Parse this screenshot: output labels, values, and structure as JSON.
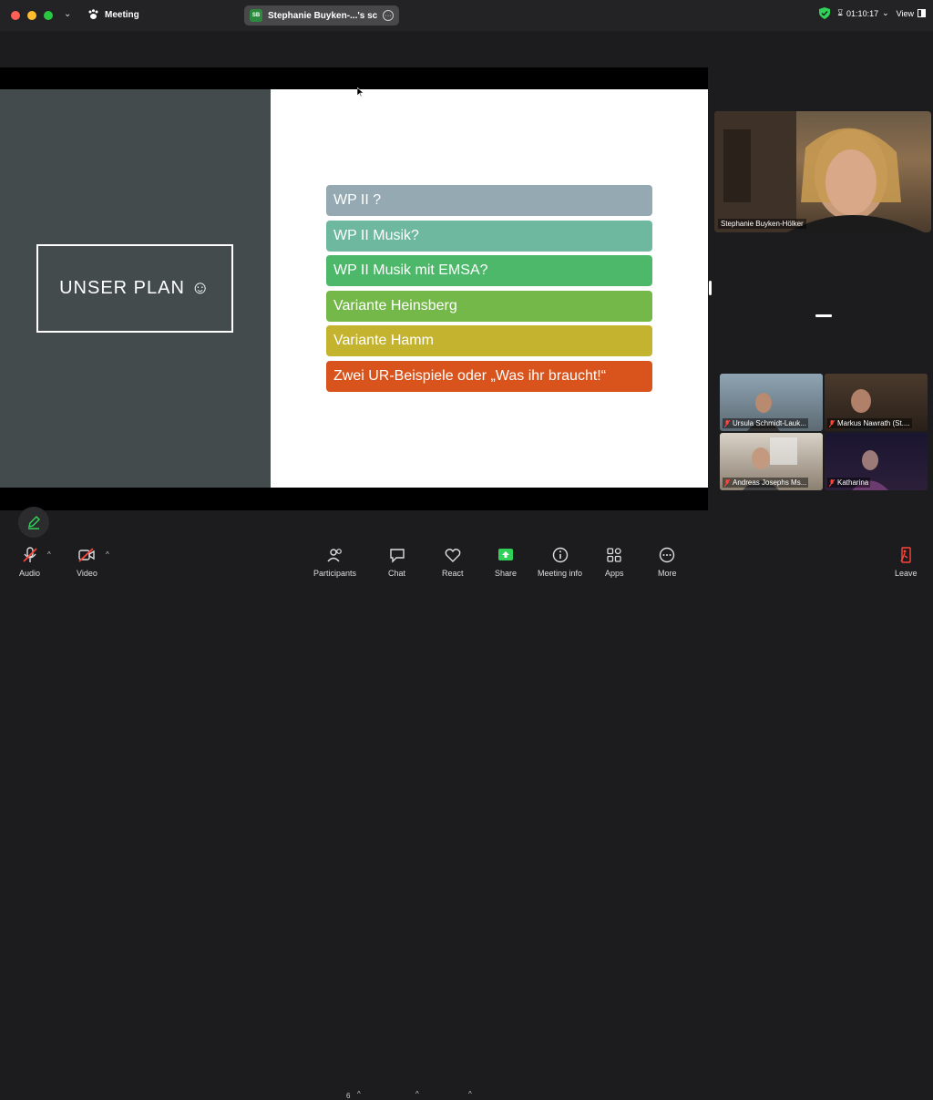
{
  "titlebar": {
    "meeting_label": "Meeting",
    "share_badge": "SB",
    "share_text": "Stephanie Buyken-...'s screen",
    "timer": "01:10:17",
    "view_label": "View"
  },
  "slide": {
    "plan_title": "UNSER PLAN ☺",
    "bars": [
      {
        "label": "WP II ?",
        "color": "#94a9b1"
      },
      {
        "label": "WP II Musik?",
        "color": "#6eb8a0"
      },
      {
        "label": "WP II Musik mit EMSA?",
        "color": "#4db86a"
      },
      {
        "label": "Variante Heinsberg",
        "color": "#74b84a"
      },
      {
        "label": "Variante Hamm",
        "color": "#c4b32e"
      },
      {
        "label": "Zwei UR-Beispiele oder „Was ihr braucht!“",
        "color": "#d9531c"
      }
    ]
  },
  "participants": {
    "speaker": "Stephanie Buyken-Hölker",
    "gallery": [
      {
        "name": "Ursula Schmidt-Lauk..."
      },
      {
        "name": "Markus Nawrath (St...."
      },
      {
        "name": "Andreas Josephs Ms..."
      },
      {
        "name": "Katharina"
      }
    ]
  },
  "toolbar": {
    "audio": "Audio",
    "video": "Video",
    "participants": "Participants",
    "participants_count": "6",
    "chat": "Chat",
    "react": "React",
    "share": "Share",
    "meeting_info": "Meeting info",
    "apps": "Apps",
    "more": "More",
    "leave": "Leave"
  }
}
